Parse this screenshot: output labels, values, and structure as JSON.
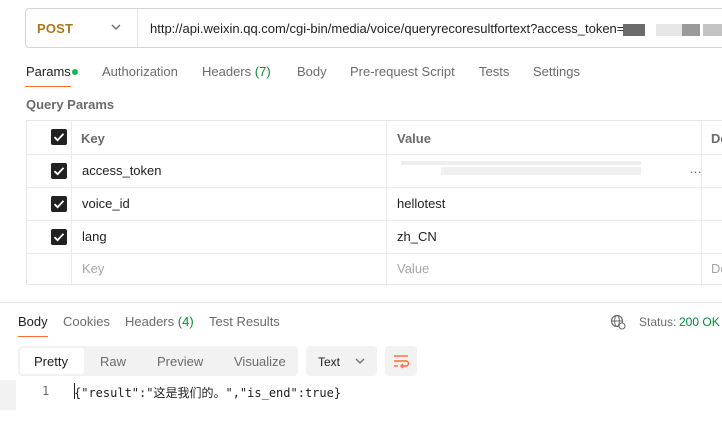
{
  "request": {
    "method": "POST",
    "url": "http://api.weixin.qq.com/cgi-bin/media/voice/queryrecoresultfortext?access_token="
  },
  "request_tabs": [
    {
      "label": "Params",
      "badge": ""
    },
    {
      "label": "Authorization",
      "badge": ""
    },
    {
      "label": "Headers",
      "badge": "(7)"
    },
    {
      "label": "Body",
      "badge": ""
    },
    {
      "label": "Pre-request Script",
      "badge": ""
    },
    {
      "label": "Tests",
      "badge": ""
    },
    {
      "label": "Settings",
      "badge": ""
    }
  ],
  "query_params": {
    "title": "Query Params",
    "columns": [
      "Key",
      "Value",
      "De"
    ],
    "rows": [
      {
        "key": "access_token",
        "value": "…",
        "checked": true
      },
      {
        "key": "voice_id",
        "value": "hellotest",
        "checked": true
      },
      {
        "key": "lang",
        "value": "zh_CN",
        "checked": true
      }
    ],
    "placeholder_key": "Key",
    "placeholder_value": "Value",
    "placeholder_desc": "De"
  },
  "response_tabs": [
    {
      "label": "Body",
      "badge": ""
    },
    {
      "label": "Cookies",
      "badge": ""
    },
    {
      "label": "Headers",
      "badge": "(4)"
    },
    {
      "label": "Test Results",
      "badge": ""
    }
  ],
  "status": {
    "label": "Status:",
    "value": "200 OK"
  },
  "format_options": [
    "Pretty",
    "Raw",
    "Preview",
    "Visualize"
  ],
  "language_select": "Text",
  "response_body": {
    "line_number": "1",
    "text": "{\"result\":\"这是我们的。\",\"is_end\":true}"
  },
  "colors": {
    "accent": "#ff6c37",
    "method": "#a9781a",
    "success": "#0a8a3a"
  },
  "icons": [
    "chevron-down-icon",
    "checkbox-checked-icon",
    "globe-icon",
    "wrap-lines-icon"
  ]
}
